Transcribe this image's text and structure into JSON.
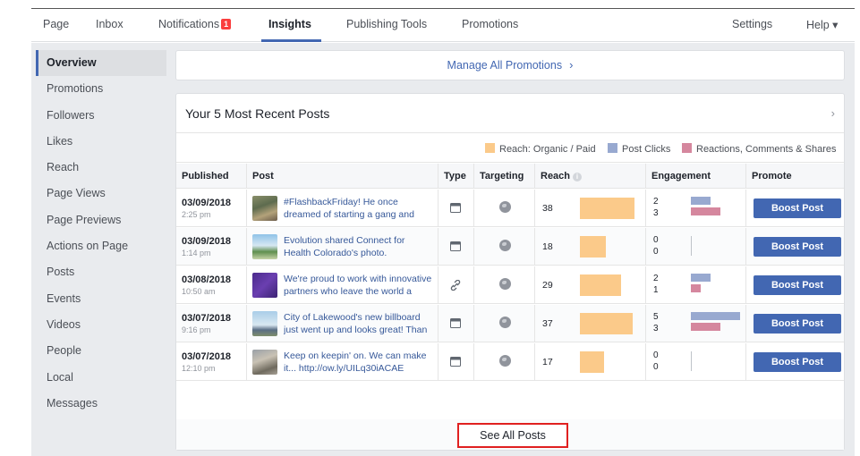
{
  "nav": {
    "left": [
      "Page",
      "Inbox",
      "Notifications",
      "Insights",
      "Publishing Tools",
      "Promotions"
    ],
    "notif_count": "1",
    "right": [
      "Settings",
      "Help ▾"
    ]
  },
  "sidebar": [
    "Overview",
    "Promotions",
    "Followers",
    "Likes",
    "Reach",
    "Page Views",
    "Page Previews",
    "Actions on Page",
    "Posts",
    "Events",
    "Videos",
    "People",
    "Local",
    "Messages"
  ],
  "promo": {
    "label": "Manage All Promotions"
  },
  "card": {
    "title": "Your 5 Most Recent Posts",
    "legend": [
      "Reach: Organic / Paid",
      "Post Clicks",
      "Reactions, Comments & Shares"
    ],
    "legend_colors": [
      "#fbca8a",
      "#98a9d0",
      "#d5879e"
    ],
    "columns": [
      "Published",
      "Post",
      "Type",
      "Targeting",
      "Reach",
      "Engagement",
      "Promote"
    ],
    "rows": [
      {
        "date": "03/09/2018",
        "time": "2:25 pm",
        "text": "#FlashbackFriday! He once dreamed of starting a gang and riding t",
        "type": "photo-icon",
        "reach": 38,
        "clicks": 2,
        "reactions": 3,
        "boost": "Boost Post"
      },
      {
        "date": "03/09/2018",
        "time": "1:14 pm",
        "text": "Evolution shared Connect for Health Colorado's photo.",
        "type": "photo-icon",
        "reach": 18,
        "clicks": 0,
        "reactions": 0,
        "boost": "Boost Post"
      },
      {
        "date": "03/08/2018",
        "time": "10:50 am",
        "text": "We're proud to work with innovative partners who leave the world a",
        "type": "link-icon",
        "reach": 29,
        "clicks": 2,
        "reactions": 1,
        "boost": "Boost Post"
      },
      {
        "date": "03/07/2018",
        "time": "9:16 pm",
        "text": "City of Lakewood's new billboard just went up and looks great! Than",
        "type": "photo-icon",
        "reach": 37,
        "clicks": 5,
        "reactions": 3,
        "boost": "Boost Post"
      },
      {
        "date": "03/07/2018",
        "time": "12:10 pm",
        "text": "Keep on keepin' on. We can make it... http://ow.ly/UILq30iACAE",
        "type": "photo-icon",
        "reach": 17,
        "clicks": 0,
        "reactions": 0,
        "boost": "Boost Post"
      }
    ],
    "see_all": "See All Posts"
  }
}
